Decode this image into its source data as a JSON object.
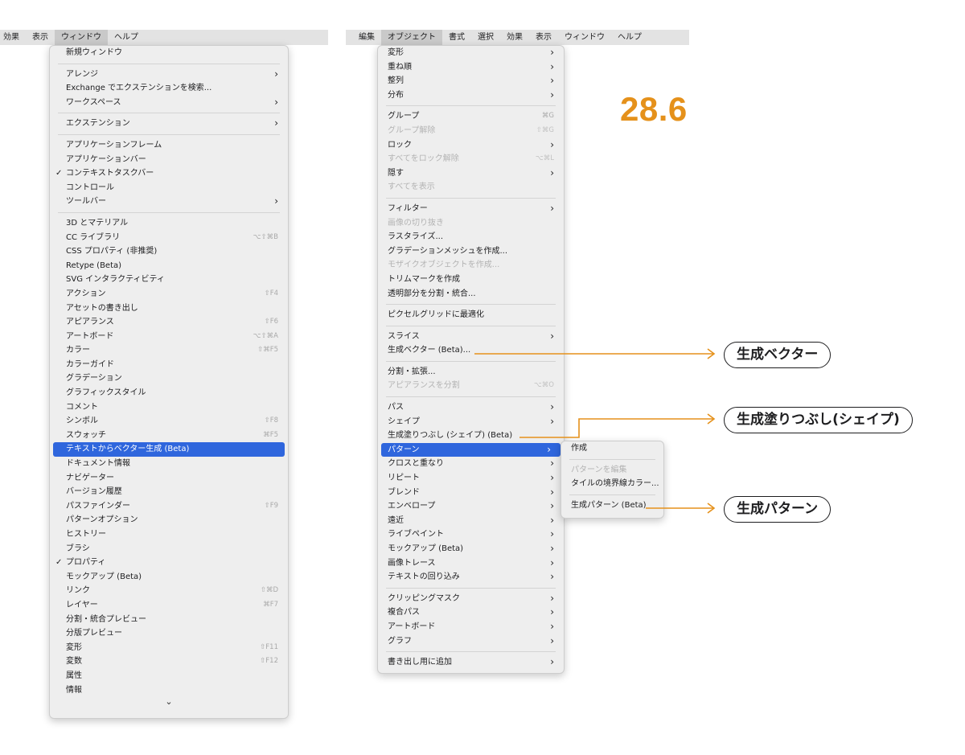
{
  "menubar_left": [
    "効果",
    "表示",
    "ウィンドウ",
    "ヘルプ"
  ],
  "menubar_right": [
    "編集",
    "オブジェクト",
    "書式",
    "選択",
    "効果",
    "表示",
    "ウィンドウ",
    "ヘルプ"
  ],
  "window_menu": [
    {
      "label": "新規ウィンドウ"
    },
    {
      "sep": true
    },
    {
      "label": "アレンジ",
      "submenu": true
    },
    {
      "label": "Exchange でエクステンションを検索..."
    },
    {
      "label": "ワークスペース",
      "submenu": true
    },
    {
      "sep": true
    },
    {
      "label": "エクステンション",
      "submenu": true
    },
    {
      "sep": true
    },
    {
      "label": "アプリケーションフレーム"
    },
    {
      "label": "アプリケーションバー"
    },
    {
      "label": "コンテキストタスクバー",
      "checked": true
    },
    {
      "label": "コントロール"
    },
    {
      "label": "ツールバー",
      "submenu": true
    },
    {
      "sep": true
    },
    {
      "label": "3D とマテリアル"
    },
    {
      "label": "CC ライブラリ",
      "shortcut": "⌥⇧⌘B"
    },
    {
      "label": "CSS プロパティ (非推奨)"
    },
    {
      "label": "Retype (Beta)"
    },
    {
      "label": "SVG インタラクティビティ"
    },
    {
      "label": "アクション",
      "shortcut": "⇧F4"
    },
    {
      "label": "アセットの書き出し"
    },
    {
      "label": "アピアランス",
      "shortcut": "⇧F6"
    },
    {
      "label": "アートボード",
      "shortcut": "⌥⇧⌘A"
    },
    {
      "label": "カラー",
      "shortcut": "⇧⌘F5"
    },
    {
      "label": "カラーガイド"
    },
    {
      "label": "グラデーション"
    },
    {
      "label": "グラフィックスタイル"
    },
    {
      "label": "コメント"
    },
    {
      "label": "シンボル",
      "shortcut": "⇧F8"
    },
    {
      "label": "スウォッチ",
      "shortcut": "⌘F5"
    },
    {
      "label": "テキストからベクター生成 (Beta)",
      "highlighted": true
    },
    {
      "label": "ドキュメント情報"
    },
    {
      "label": "ナビゲーター"
    },
    {
      "label": "バージョン履歴"
    },
    {
      "label": "パスファインダー",
      "shortcut": "⇧F9"
    },
    {
      "label": "パターンオプション"
    },
    {
      "label": "ヒストリー"
    },
    {
      "label": "ブラシ"
    },
    {
      "label": "プロパティ",
      "checked": true
    },
    {
      "label": "モックアップ (Beta)"
    },
    {
      "label": "リンク",
      "shortcut": "⇧⌘D"
    },
    {
      "label": "レイヤー",
      "shortcut": "⌘F7"
    },
    {
      "label": "分割・統合プレビュー"
    },
    {
      "label": "分版プレビュー"
    },
    {
      "label": "変形",
      "shortcut": "⇧F11"
    },
    {
      "label": "変数",
      "shortcut": "⇧F12"
    },
    {
      "label": "属性"
    },
    {
      "label": "情報"
    }
  ],
  "window_menu_scroll_glyph": "⌄",
  "object_menu": [
    {
      "label": "変形",
      "submenu": true
    },
    {
      "label": "重ね順",
      "submenu": true
    },
    {
      "label": "整列",
      "submenu": true
    },
    {
      "label": "分布",
      "submenu": true
    },
    {
      "sep": true
    },
    {
      "label": "グループ",
      "shortcut": "⌘G"
    },
    {
      "label": "グループ解除",
      "shortcut": "⇧⌘G",
      "disabled": true
    },
    {
      "label": "ロック",
      "submenu": true
    },
    {
      "label": "すべてをロック解除",
      "shortcut": "⌥⌘L",
      "disabled": true
    },
    {
      "label": "隠す",
      "submenu": true
    },
    {
      "label": "すべてを表示",
      "disabled": true
    },
    {
      "sep": true
    },
    {
      "label": "フィルター",
      "submenu": true
    },
    {
      "label": "画像の切り抜き",
      "disabled": true
    },
    {
      "label": "ラスタライズ..."
    },
    {
      "label": "グラデーションメッシュを作成..."
    },
    {
      "label": "モザイクオブジェクトを作成...",
      "disabled": true
    },
    {
      "label": "トリムマークを作成"
    },
    {
      "label": "透明部分を分割・統合..."
    },
    {
      "sep": true
    },
    {
      "label": "ピクセルグリッドに最適化"
    },
    {
      "sep": true
    },
    {
      "label": "スライス",
      "submenu": true
    },
    {
      "label": "生成ベクター (Beta)..."
    },
    {
      "sep": true
    },
    {
      "label": "分割・拡張..."
    },
    {
      "label": "アピアランスを分割",
      "shortcut": "⌥⌘O",
      "disabled": true
    },
    {
      "sep": true
    },
    {
      "label": "パス",
      "submenu": true
    },
    {
      "label": "シェイプ",
      "submenu": true
    },
    {
      "label": "生成塗りつぶし (シェイプ) (Beta)"
    },
    {
      "label": "パターン",
      "submenu": true,
      "highlighted": true
    },
    {
      "label": "クロスと重なり",
      "submenu": true
    },
    {
      "label": "リピート",
      "submenu": true
    },
    {
      "label": "ブレンド",
      "submenu": true
    },
    {
      "label": "エンベロープ",
      "submenu": true
    },
    {
      "label": "遠近",
      "submenu": true
    },
    {
      "label": "ライブペイント",
      "submenu": true
    },
    {
      "label": "モックアップ (Beta)",
      "submenu": true
    },
    {
      "label": "画像トレース",
      "submenu": true
    },
    {
      "label": "テキストの回り込み",
      "submenu": true
    },
    {
      "sep": true
    },
    {
      "label": "クリッピングマスク",
      "submenu": true
    },
    {
      "label": "複合パス",
      "submenu": true
    },
    {
      "label": "アートボード",
      "submenu": true
    },
    {
      "label": "グラフ",
      "submenu": true
    },
    {
      "sep": true
    },
    {
      "label": "書き出し用に追加",
      "submenu": true
    }
  ],
  "pattern_submenu": [
    {
      "label": "作成"
    },
    {
      "sep": true
    },
    {
      "label": "パターンを編集",
      "disabled": true
    },
    {
      "label": "タイルの境界線カラー..."
    },
    {
      "sep": true
    },
    {
      "label": "生成パターン (Beta)"
    }
  ],
  "version": "28.6",
  "callouts": {
    "generative_vector": "生成ベクター",
    "generative_fill_shape": "生成塗りつぶし(シェイプ)",
    "generative_pattern": "生成パターン"
  },
  "glyphs": {
    "check": "✓",
    "submenu_arrow": "›"
  },
  "colors": {
    "accent_orange": "#e5911b",
    "highlight_blue": "#2f66dd",
    "menubar_bg": "#e3e3e3",
    "menu_bg": "#eeeeee",
    "disabled_text": "#b3b3b3"
  }
}
